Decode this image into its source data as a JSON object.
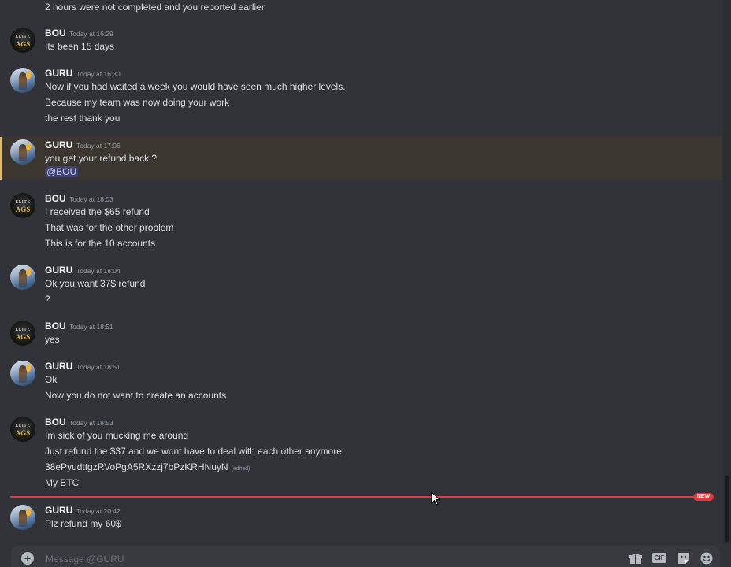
{
  "top_partial_line": "2 hours were not completed and you reported earlier",
  "messages": [
    {
      "author": "BOU",
      "timestamp": "Today at 16:29",
      "lines": [
        "Its been 15 days"
      ]
    },
    {
      "author": "GURU",
      "timestamp": "Today at 16:30",
      "lines": [
        "Now if you had waited a week you would have seen much higher levels.",
        "Because my team was now doing your work",
        "the rest thank you"
      ]
    },
    {
      "author": "GURU",
      "timestamp": "Today at 17:06",
      "lines": [
        "you get your refund back ?"
      ],
      "mention": "@BOU",
      "highlighted": true
    },
    {
      "author": "BOU",
      "timestamp": "Today at 18:03",
      "lines": [
        "I received the $65 refund",
        "That was for the other problem",
        "This is for the 10 accounts"
      ]
    },
    {
      "author": "GURU",
      "timestamp": "Today at 18:04",
      "lines": [
        "Ok you want 37$ refund",
        "?"
      ]
    },
    {
      "author": "BOU",
      "timestamp": "Today at 18:51",
      "lines": [
        "yes"
      ]
    },
    {
      "author": "GURU",
      "timestamp": "Today at 18:51",
      "lines": [
        "Ok",
        "Now you do not want to create an accounts"
      ]
    },
    {
      "author": "BOU",
      "timestamp": "Today at 18:53",
      "lines": [
        "Im sick of you mucking me around",
        "Just refund the $37 and we wont have to deal with each other anymore",
        "38ePyudttgzRVoPgA5RXzzj7bPzKRHNuyN",
        "My BTC"
      ],
      "edited_label": "(edited)"
    },
    {
      "author": "GURU",
      "timestamp": "Today at 20:42",
      "lines": [
        "Plz refund my 60$"
      ]
    }
  ],
  "avatar_bou": {
    "logo_top": "ELITE",
    "logo_bottom": "AGS"
  },
  "new_badge": "NEW",
  "composer": {
    "placeholder": "Message @GURU"
  },
  "icons": [
    "add-icon",
    "gift-icon",
    "gif-icon",
    "sticker-icon",
    "emoji-icon"
  ],
  "colors": {
    "background": "#313338",
    "highlight": "#e6b85c",
    "new_divider": "#d83c3e",
    "mention_bg": "#3e4270"
  }
}
